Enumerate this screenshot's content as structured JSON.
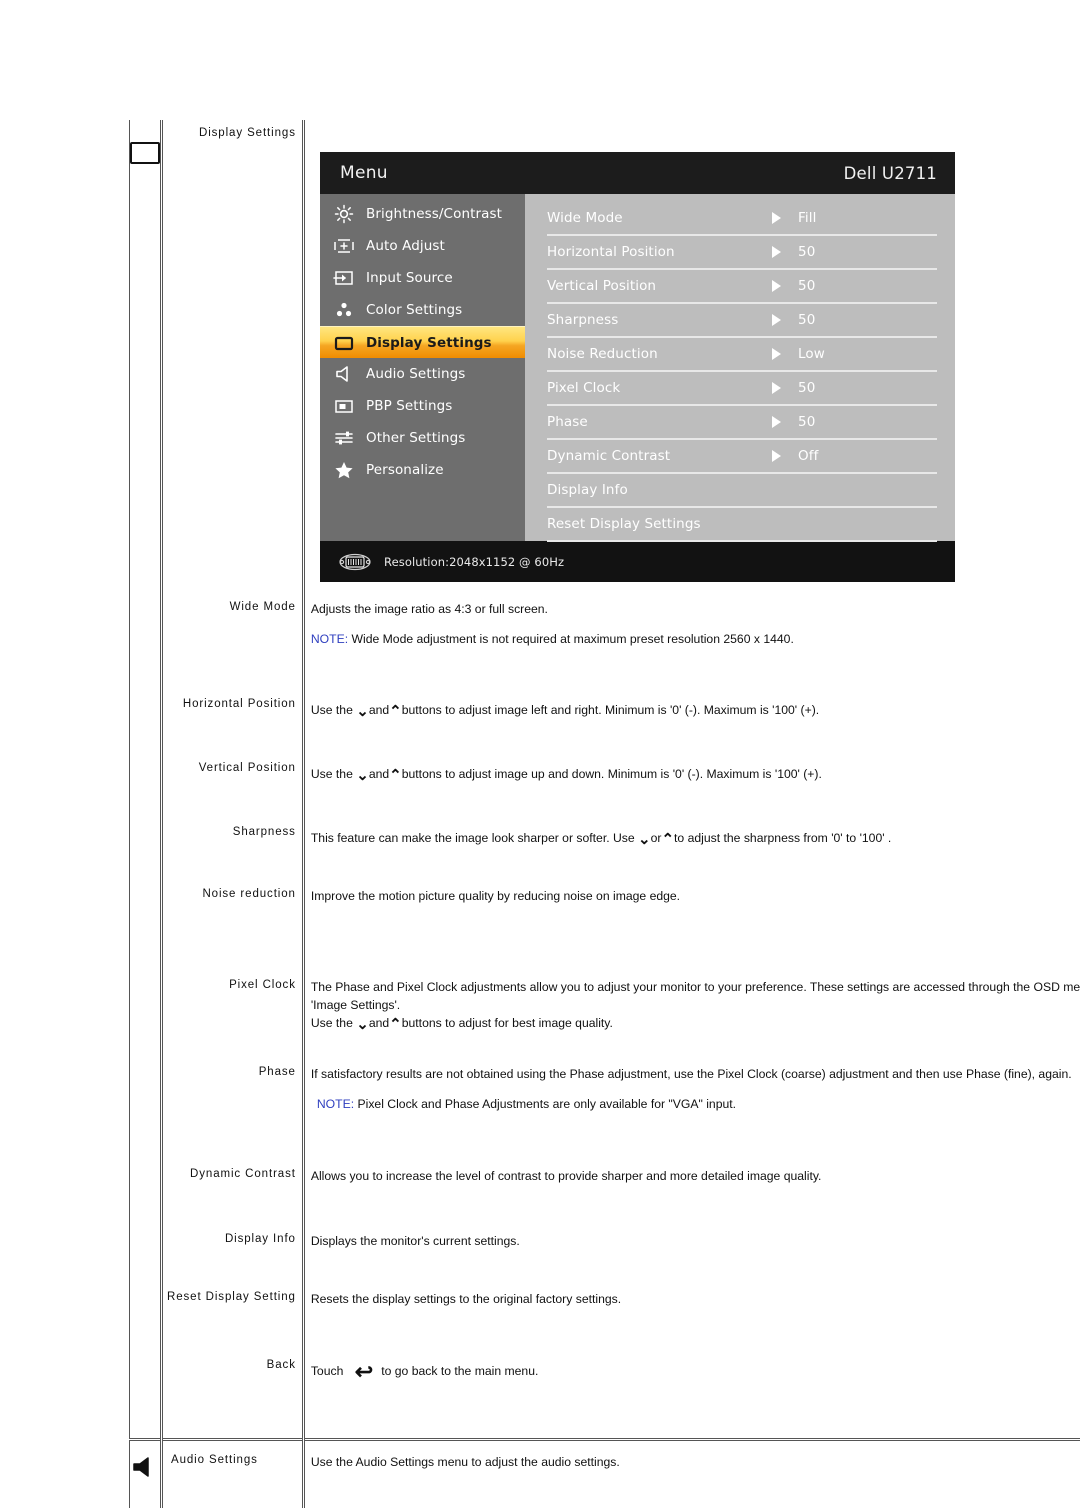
{
  "osd": {
    "title": "Menu",
    "brand": "Dell U2711",
    "sidebar": [
      {
        "label": "Brightness/Contrast",
        "icon": "brightness-icon",
        "selected": false
      },
      {
        "label": "Auto Adjust",
        "icon": "auto-adjust-icon",
        "selected": false
      },
      {
        "label": "Input Source",
        "icon": "input-source-icon",
        "selected": false
      },
      {
        "label": "Color Settings",
        "icon": "color-settings-icon",
        "selected": false
      },
      {
        "label": "Display Settings",
        "icon": "display-settings-icon",
        "selected": true
      },
      {
        "label": "Audio Settings",
        "icon": "speaker-icon",
        "selected": false
      },
      {
        "label": "PBP Settings",
        "icon": "pbp-icon",
        "selected": false
      },
      {
        "label": "Other Settings",
        "icon": "sliders-icon",
        "selected": false
      },
      {
        "label": "Personalize",
        "icon": "star-icon",
        "selected": false
      }
    ],
    "items": [
      {
        "label": "Wide Mode",
        "value": "Fill",
        "has_arrow": true
      },
      {
        "label": "Horizontal Position",
        "value": "50",
        "has_arrow": true
      },
      {
        "label": "Vertical Position",
        "value": "50",
        "has_arrow": true
      },
      {
        "label": "Sharpness",
        "value": "50",
        "has_arrow": true
      },
      {
        "label": "Noise Reduction",
        "value": "Low",
        "has_arrow": true
      },
      {
        "label": "Pixel Clock",
        "value": "50",
        "has_arrow": true
      },
      {
        "label": "Phase",
        "value": "50",
        "has_arrow": true
      },
      {
        "label": "Dynamic Contrast",
        "value": "Off",
        "has_arrow": true
      },
      {
        "label": "Display Info",
        "value": "",
        "has_arrow": false
      },
      {
        "label": "Reset Display Settings",
        "value": "",
        "has_arrow": false
      }
    ],
    "footer_resolution": "Resolution:2048x1152 @ 60Hz"
  },
  "table": {
    "section_title": "Display Settings",
    "audio_section_title": "Audio Settings",
    "audio_description": "Use the Audio Settings menu to adjust the audio settings.",
    "rows": {
      "wide_mode": {
        "label": "Wide Mode",
        "line1": "Adjusts the image ratio as 4:3 or full screen.",
        "note_tag": "NOTE:",
        "note_text": " Wide Mode adjustment is not required at maximum preset resolution 2560 x 1440."
      },
      "horizontal_position": {
        "label": "Horizontal Position",
        "pre": "Use the ",
        "mid": "and",
        "post": "buttons to adjust image left and right. Minimum is '0' (-). Maximum is '100' (+)."
      },
      "vertical_position": {
        "label": "Vertical Position",
        "pre": "Use the ",
        "mid": "and",
        "post": "buttons to adjust image up and down. Minimum is '0' (-). Maximum is '100' (+)."
      },
      "sharpness": {
        "label": "Sharpness",
        "pre": "This feature can make the image look sharper or softer. Use ",
        "mid": "or",
        "post": "to adjust the sharpness from '0' to '100' ."
      },
      "noise_reduction": {
        "label": "Noise reduction",
        "text": "Improve the motion picture quality by reducing noise on image edge."
      },
      "pixel_clock": {
        "label": "Pixel Clock",
        "line1": "The Phase and Pixel Clock adjustments allow you to adjust your monitor to your preference. These settings are accessed through the OSD menu by selecting 'Image Settings'.",
        "line2": "'Image Settings'.",
        "pre": "Use the ",
        "mid": "and",
        "post": "buttons to adjust for best image quality."
      },
      "phase": {
        "label": "Phase",
        "line1": "If satisfactory results are not obtained using the Phase adjustment, use the Pixel Clock (coarse) adjustment and then use Phase (fine), again.",
        "note_tag": "NOTE:",
        "note_text": " Pixel Clock and Phase Adjustments are only available for \"VGA\" input."
      },
      "dynamic_contrast": {
        "label": "Dynamic Contrast",
        "text": "Allows you to increase the level of contrast to provide sharper and more detailed image quality."
      },
      "display_info": {
        "label": "Display Info",
        "text": "Displays the monitor's current settings."
      },
      "reset_display_setting": {
        "label": "Reset Display Setting",
        "text": "Resets the display settings to the original factory settings."
      },
      "back": {
        "label": "Back",
        "pre": "Touch ",
        "post": "to go back to the main menu."
      }
    }
  },
  "glyphs": {
    "down_arrow": "⌄",
    "up_arrow": "⌃",
    "back_arrow": "↩"
  }
}
